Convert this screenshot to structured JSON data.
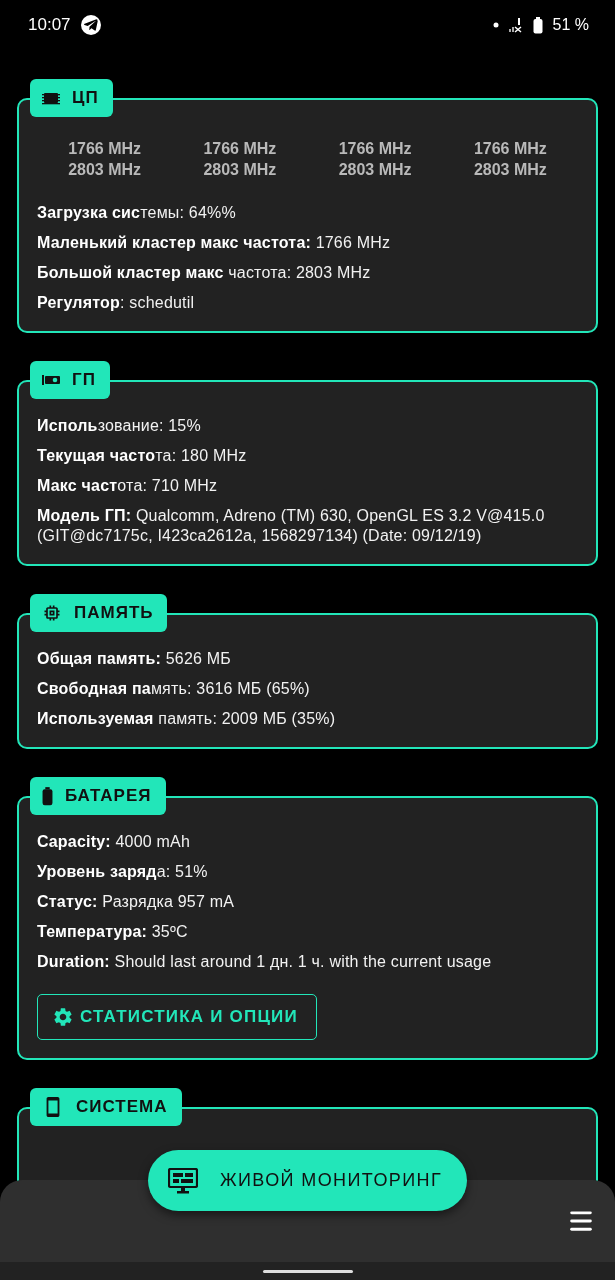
{
  "status_bar": {
    "time": "10:07",
    "battery": "51 %"
  },
  "sections": [
    {
      "kind": "cpu",
      "title": "ЦП",
      "cores": [
        [
          "1766 MHz",
          "2803 MHz"
        ],
        [
          "1766 MHz",
          "2803 MHz"
        ],
        [
          "1766 MHz",
          "2803 MHz"
        ],
        [
          "1766 MHz",
          "2803 MHz"
        ]
      ],
      "lines": [
        "**Загрузка сис**темы: 64%%",
        "**Маленький кластер макс частота:** 1766 MHz",
        "**Большой кластер макс** частота: 2803 MHz",
        "**Регулятор**: schedutil"
      ]
    },
    {
      "kind": "gpu",
      "title": "ГП",
      "lines": [
        "**Исполь**зование: 15%",
        "**Текущая часто**та: 180 MHz",
        "**Макс част**ота: 710 MHz",
        "**Модель ГП:** Qualcomm, Adreno (TM) 630, OpenGL ES 3.2 V@415.0 (GIT@dc7175c, I423ca2612a, 1568297134) (Date: 09/12/19)"
      ]
    },
    {
      "kind": "memory",
      "title": "ПАМЯТЬ",
      "lines": [
        "**Общая память:** 5626 МБ",
        "**Свободная па**мять: 3616 МБ (65%)",
        "**Используемая** память: 2009 МБ (35%)"
      ]
    },
    {
      "kind": "battery",
      "title": "БАТАРЕЯ",
      "lines": [
        "**Capacity:** 4000 mAh",
        "**Уровень заряд**а: 51%",
        "**Статус:** Разрядка 957 mA",
        "**Температура:** 35ºC",
        "**Duration:** Should last around 1 дн. 1 ч. with the current usage"
      ],
      "button": "СТАТИСТИКА И ОПЦИИ"
    },
    {
      "kind": "system",
      "title": "СИСТЕМА"
    }
  ],
  "fab": {
    "label": "ЖИВОЙ МОНИТОРИНГ"
  }
}
